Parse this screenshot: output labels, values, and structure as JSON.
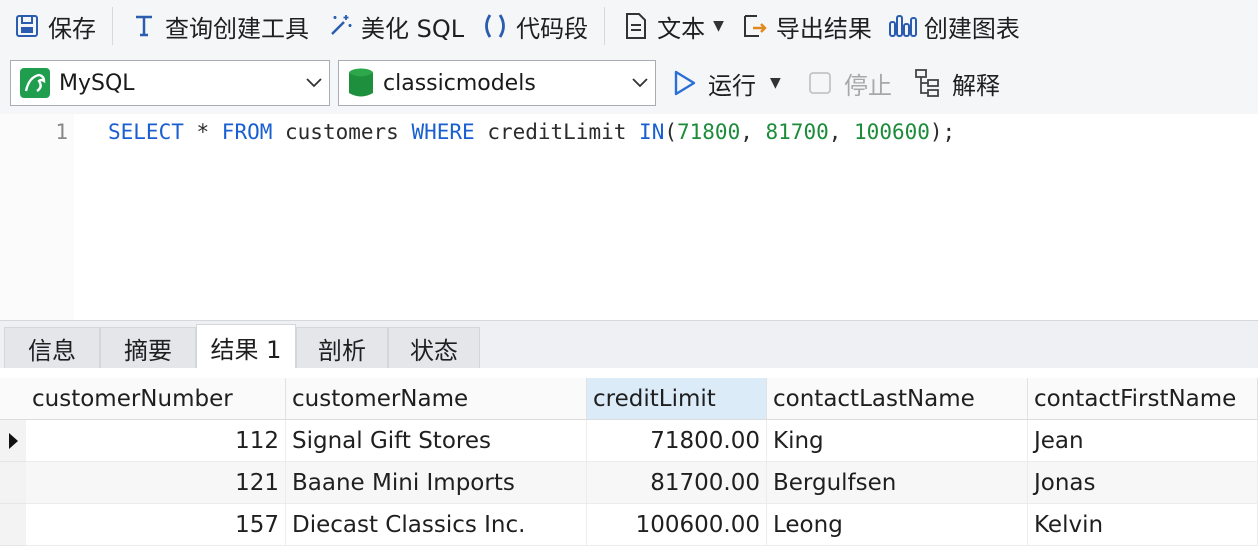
{
  "toolbar": {
    "save_label": "保存",
    "query_builder_label": "查询创建工具",
    "beautify_label": "美化 SQL",
    "snippet_label": "代码段",
    "text_label": "文本",
    "export_label": "导出结果",
    "chart_label": "创建图表"
  },
  "connection": {
    "value": "MySQL"
  },
  "database": {
    "value": "classicmodels"
  },
  "run": {
    "run_label": "运行",
    "stop_label": "停止",
    "explain_label": "解释"
  },
  "editor": {
    "line_number": "1",
    "tokens": {
      "select": "SELECT",
      "star": " * ",
      "from": "FROM",
      "table": " customers ",
      "where": "WHERE",
      "column": " creditLimit ",
      "in": "IN",
      "open": "(",
      "n1": "71800",
      "c1": ", ",
      "n2": "81700",
      "c2": ", ",
      "n3": "100600",
      "close": ");"
    }
  },
  "tabs": [
    "信息",
    "摘要",
    "结果 1",
    "剖析",
    "状态"
  ],
  "grid": {
    "columns": [
      "customerNumber",
      "customerName",
      "creditLimit",
      "contactLastName",
      "contactFirstName"
    ],
    "rows": [
      [
        "112",
        "Signal Gift Stores",
        "71800.00",
        "King",
        "Jean"
      ],
      [
        "121",
        "Baane Mini Imports",
        "81700.00",
        "Bergulfsen",
        "Jonas"
      ],
      [
        "157",
        "Diecast Classics Inc.",
        "100600.00",
        "Leong",
        "Kelvin"
      ]
    ]
  }
}
